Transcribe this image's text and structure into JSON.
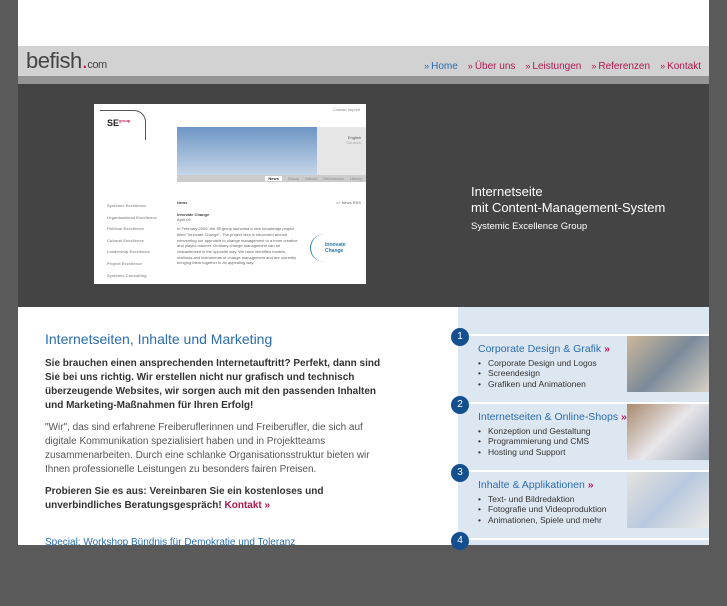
{
  "logo": {
    "name": "befish",
    "dot": ".",
    "tld": "com"
  },
  "nav": [
    {
      "label": "Home"
    },
    {
      "label": "Über uns"
    },
    {
      "label": "Leistungen"
    },
    {
      "label": "Referenzen"
    },
    {
      "label": "Kontakt"
    }
  ],
  "nav_arrow": "»",
  "hero": {
    "title_line1": "Internetseite",
    "title_line2": "mit Content-Management-System",
    "client": "Systemic Excellence Group",
    "screenshot": {
      "logo": "SE",
      "logo_sup": "group",
      "top_links": "Contact  Imprint",
      "lang": [
        "English",
        "Deutsch"
      ],
      "tabs": [
        "News",
        "Group",
        "Offices",
        "References",
        "Library"
      ],
      "side": [
        "Systemic Excellence",
        "Organisational Excellence",
        "Political Excellence",
        "Cultural Excellence",
        "Leadership Excellence",
        "Project Excellence",
        "Systemic Consulting"
      ],
      "news_head": "News",
      "rss": ">> News RSS",
      "article_title": "Innovate Change",
      "article_date": "April 09",
      "article_text": "In February 2009, the SEgroup launched a new knowledge project titled \"Innovate Change\". The project idea is structured around reinventing our approach to change management to a more creative and playful manner. Ordinary change management can be characterised in the opposite way. We have identified models, methods and instruments of change management and are currently bringing them together in an appealing way.",
      "badge": "Innovate Change"
    }
  },
  "main": {
    "heading": "Internetseiten, Inhalte und Marketing",
    "lead": "Sie brauchen einen ansprechenden Internetauftritt? Perfekt, dann sind Sie bei uns richtig. Wir erstellen nicht nur grafisch und technisch überzeugende Websites, wir sorgen auch mit den passenden Inhalten und Marketing-Maßnahmen für Ihren Erfolg!",
    "body": "\"Wir\", das sind erfahrene Freiberuflerinnen und Freiberufler, die sich auf digitale Kommunikation spezialisiert haben und in Projektteams zusammenarbeiten. Durch eine schlanke Organisationsstruktur bieten wir Ihnen professionelle Leistungen zu besonders fairen Preisen.",
    "cta": "Probieren Sie es aus: Vereinbaren Sie ein kostenloses und unverbindliches Beratungsgespräch!",
    "cta_link": "Kontakt »",
    "special": "Special: Workshop Bündnis für Demokratie und Toleranz"
  },
  "services": [
    {
      "num": "1",
      "title": "Corporate Design & Grafik",
      "items": [
        "Corporate Design und Logos",
        "Screendesign",
        "Grafiken und Animationen"
      ]
    },
    {
      "num": "2",
      "title": "Internetseiten & Online-Shops",
      "items": [
        "Konzeption und Gestaltung",
        "Programmierung und CMS",
        "Hosting und Support"
      ]
    },
    {
      "num": "3",
      "title": "Inhalte & Applikationen",
      "items": [
        "Text- und Bildredaktion",
        "Fotografie und Videoproduktion",
        "Animationen, Spiele und mehr"
      ]
    },
    {
      "num": "4"
    }
  ],
  "service_arrow": "»",
  "colors": {
    "accent_blue": "#2a6db0",
    "accent_magenta": "#b0184f",
    "hero_bg": "#444444",
    "panel_bg": "#dde7f1"
  }
}
